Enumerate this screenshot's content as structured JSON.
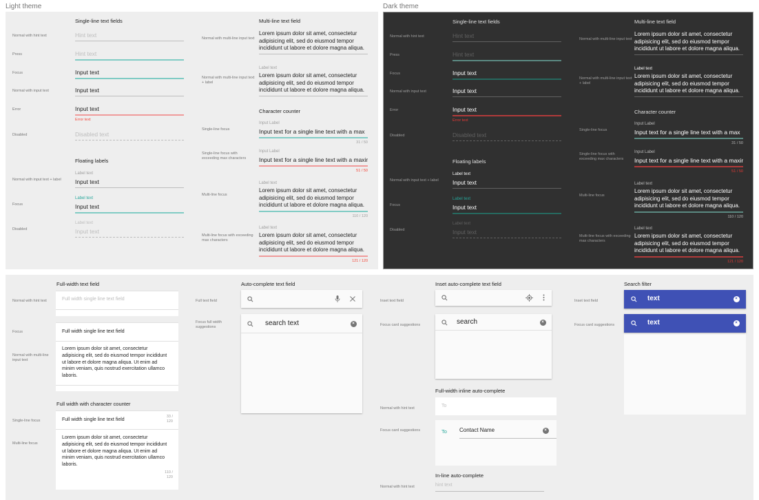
{
  "light": {
    "title": "Light theme",
    "single": {
      "title": "Single-line text fields",
      "rows": [
        {
          "label": "Normal with hint text",
          "value": "Hint text"
        },
        {
          "label": "Press",
          "value": "Hint text"
        },
        {
          "label": "Focus",
          "value": "Input text"
        },
        {
          "label": "Normal with input text",
          "value": "Input text"
        },
        {
          "label": "Error",
          "value": "Input text",
          "error": "Error text"
        },
        {
          "label": "Disabled",
          "value": "Disabled text"
        }
      ]
    },
    "floating": {
      "title": "Floating labels",
      "rows": [
        {
          "label": "Normal with input text + label",
          "field_label": "Label text",
          "value": "Input text"
        },
        {
          "label": "Focus",
          "field_label": "Label text",
          "value": "Input text"
        },
        {
          "label": "Disabled",
          "field_label": "Label text",
          "value": "Input text"
        }
      ]
    },
    "multi": {
      "title": "Multi-line text field",
      "rows": [
        {
          "label": "Normal with multi-line input text",
          "lines": [
            "Lorem ipsum dolor sit amet, consectetur",
            "adipisicing elit, sed do eiusmod tempor",
            "incididunt ut labore et dolore magna aliqua."
          ]
        },
        {
          "label": "Normal with multi-line input text + label",
          "field_label": "Label text",
          "lines": [
            "Lorem ipsum dolor sit amet, consectetur",
            "adipisicing elit, sed do eiusmod tempor",
            "incididunt ut labore et dolore magna aliqua."
          ]
        }
      ]
    },
    "counter": {
      "title": "Character counter",
      "rows": [
        {
          "label": "Single-line focus",
          "field_label": "Input Label",
          "value": "Input text for a single line text with a max",
          "count": "31 / 50"
        },
        {
          "label": "Single-line focus with exceeding max characters",
          "field_label": "Input Label",
          "value": "Input text for a single line text with a maximu",
          "count": "51 / 50"
        },
        {
          "label": "Multi-line focus",
          "field_label": "Label text",
          "lines": [
            "Lorem ipsum dolor sit amet, consectetur",
            "adipisicing elit, sed do eiusmod tempor",
            "incididunt ut labore et dolore magna aliqua."
          ],
          "count": "110 / 120"
        },
        {
          "label": "Multi-line focus with exceeding max characters",
          "field_label": "Label text",
          "lines": [
            "Lorem ipsum dolor sit amet, consectetur",
            "adipisicing elit, sed do eiusmod tempor",
            "incididunt ut labore et dolore magna aliqua."
          ],
          "count": "121 / 120"
        }
      ]
    }
  },
  "dark": {
    "title": "Dark theme"
  },
  "bottom": {
    "fullwidth": {
      "title": "Full-width text field",
      "rows": [
        {
          "label": "Normal with hint text",
          "value": "Full width single line text field"
        },
        {
          "label": "Focus",
          "value": "Full width single line text field"
        },
        {
          "label": "Normal with multi-line input text",
          "lines": [
            "Lorem ipsum dolor sit amet, consectetur",
            "adipisicing elit, sed do eiusmod tempor incididunt",
            "ut labore et dolore magna aliqua. Ut enim ad",
            "minim veniam, quis nostrud exercitation ullamco",
            "laboris."
          ]
        }
      ]
    },
    "fw_counter": {
      "title": "Full width with character counter",
      "rows": [
        {
          "label": "Single-line focus",
          "value": "Full width single line text field",
          "count": [
            "33 /",
            "120"
          ]
        },
        {
          "label": "Multi-line focus",
          "lines": [
            "Lorem ipsum dolor sit amet, consectetur",
            "adipisicing elit, sed do eiusmod tempor incididunt",
            "ut labore et dolore magna aliqua. Ut enim ad",
            "minim veniam, quis nostrud exercitation ullamco",
            "laboris."
          ],
          "count": [
            "110 /",
            "120"
          ]
        }
      ]
    },
    "autocomplete": {
      "title": "Auto-complete text field",
      "rows": [
        {
          "label": "Full text field",
          "value": ""
        },
        {
          "label": "Focus full width suggestions",
          "value": "search text"
        }
      ]
    },
    "inset": {
      "title": "Inset auto-complete text field",
      "rows": [
        {
          "label": "Inset text field",
          "value": ""
        },
        {
          "label": "Focus card suggestions",
          "value": "search"
        }
      ]
    },
    "inline_fw": {
      "title": "Full-width inline auto-complete",
      "rows": [
        {
          "label": "Normal with hint text",
          "prefix": "To"
        },
        {
          "label": "Focus card suggestions",
          "prefix": "To",
          "value": "Contact Name"
        }
      ]
    },
    "inline": {
      "title": "In-line auto-complete",
      "rows": [
        {
          "label": "Normal with hint text",
          "hint": "hint text"
        }
      ]
    },
    "search_filter": {
      "title": "Search filter",
      "accent": "#3f51b5",
      "rows": [
        {
          "label": "Inset text field",
          "value": "text"
        },
        {
          "label": "Focus card suggestions",
          "value": "text"
        }
      ]
    }
  },
  "colors": {
    "focus": "#80cbc4",
    "error": "#ef9a9a",
    "teal_label": "#26a69a",
    "error_text": "#f44336"
  }
}
